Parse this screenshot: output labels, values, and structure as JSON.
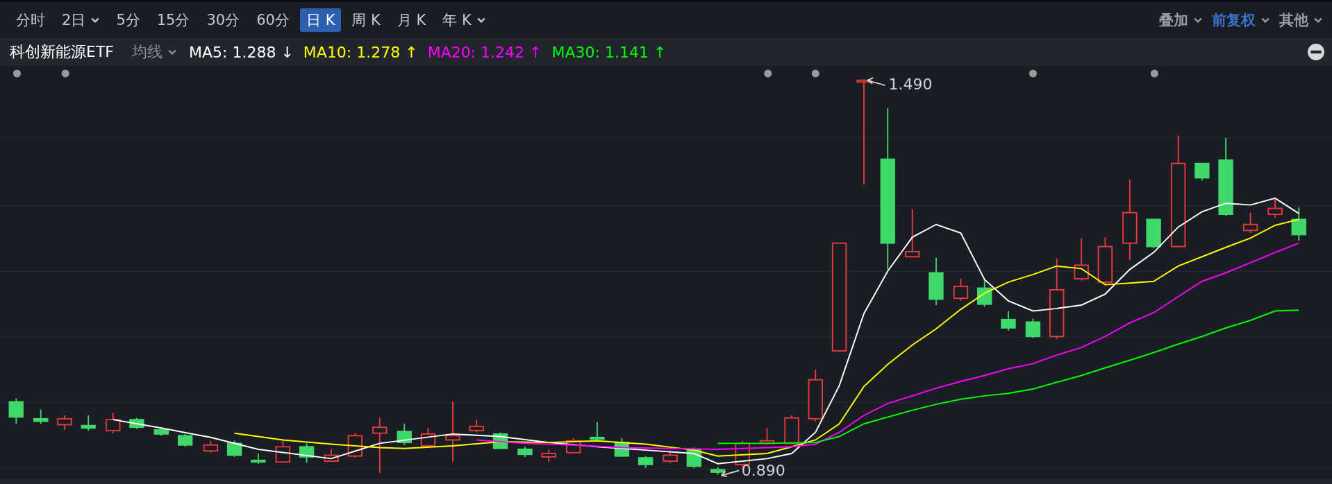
{
  "periods": [
    {
      "label": "分时",
      "selected": false,
      "dropdown": false
    },
    {
      "label": "2日",
      "selected": false,
      "dropdown": true
    },
    {
      "label": "5分",
      "selected": false,
      "dropdown": false
    },
    {
      "label": "15分",
      "selected": false,
      "dropdown": false
    },
    {
      "label": "30分",
      "selected": false,
      "dropdown": false
    },
    {
      "label": "60分",
      "selected": false,
      "dropdown": false
    },
    {
      "label": "日 K",
      "selected": true,
      "dropdown": false
    },
    {
      "label": "周 K",
      "selected": false,
      "dropdown": false
    },
    {
      "label": "月 K",
      "selected": false,
      "dropdown": false
    },
    {
      "label": "年 K",
      "selected": false,
      "dropdown": true
    }
  ],
  "options": [
    {
      "label": "叠加",
      "selected": false
    },
    {
      "label": "前复权",
      "selected": true
    },
    {
      "label": "其他",
      "selected": false
    }
  ],
  "legend": {
    "name": "科创新能源ETF",
    "indicator": "均线",
    "items": [
      {
        "label": "MA5: 1.288",
        "arrow": "↓",
        "color": "#ffffff"
      },
      {
        "label": "MA10: 1.278",
        "arrow": "↑",
        "color": "#ffff00"
      },
      {
        "label": "MA20: 1.242",
        "arrow": "↑",
        "color": "#ff00ff"
      },
      {
        "label": "MA30: 1.141",
        "arrow": "↑",
        "color": "#00ff00"
      }
    ]
  },
  "chart": {
    "high_label": "1.490",
    "low_label": "0.890"
  }
}
